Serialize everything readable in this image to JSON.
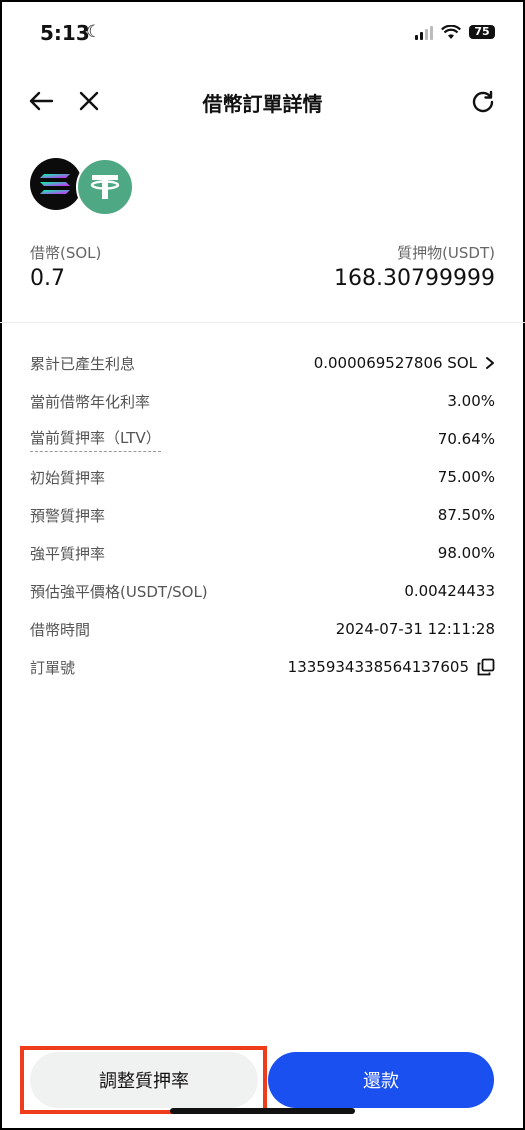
{
  "status_bar": {
    "time": "5:13",
    "battery": "75"
  },
  "nav": {
    "title": "借幣訂單詳情"
  },
  "summary": {
    "borrow_label": "借幣(SOL)",
    "borrow_value": "0.7",
    "collateral_label": "質押物(USDT)",
    "collateral_value": "168.30799999"
  },
  "details": [
    {
      "key": "累計已產生利息",
      "value": "0.000069527806 SOL"
    },
    {
      "key": "當前借幣年化利率",
      "value": "3.00%"
    },
    {
      "key": "當前質押率（LTV）",
      "value": "70.64%"
    },
    {
      "key": "初始質押率",
      "value": "75.00%"
    },
    {
      "key": "預警質押率",
      "value": "87.50%"
    },
    {
      "key": "強平質押率",
      "value": "98.00%"
    },
    {
      "key": "預估強平價格(USDT/SOL)",
      "value": "0.00424433"
    },
    {
      "key": "借幣時間",
      "value": "2024-07-31 12:11:28"
    },
    {
      "key": "訂單號",
      "value": "1335934338564137605"
    }
  ],
  "buttons": {
    "adjust": "調整質押率",
    "repay": "還款"
  },
  "colors": {
    "primary": "#1a4ff0",
    "usdt": "#4ea883",
    "highlight": "#ef3c1b"
  }
}
